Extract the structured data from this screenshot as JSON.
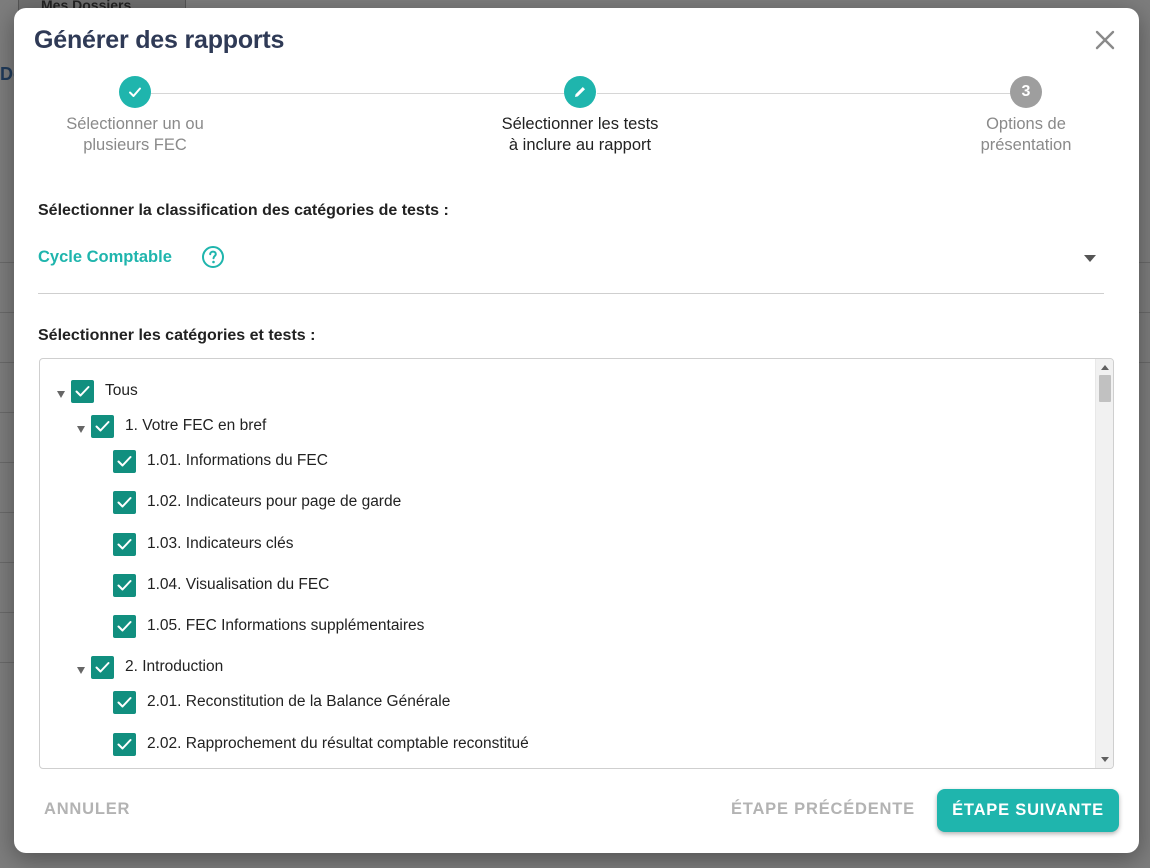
{
  "background": {
    "tab_label": "Mes Dossiers",
    "edge_text": "Do"
  },
  "modal": {
    "title": "Générer des rapports"
  },
  "stepper": {
    "steps": [
      {
        "line1": "Sélectionner un ou",
        "line2": "plusieurs FEC",
        "state": "done"
      },
      {
        "line1": "Sélectionner les tests",
        "line2": "à inclure au rapport",
        "state": "active"
      },
      {
        "line1": "Options de",
        "line2": "présentation",
        "state": "todo",
        "number": "3"
      }
    ]
  },
  "classification": {
    "label": "Sélectionner la classification des catégories de tests :",
    "selected": "Cycle Comptable"
  },
  "tree": {
    "label": "Sélectionner les catégories et tests :",
    "root": "Tous",
    "group1": "1. Votre FEC en bref",
    "g1_items": [
      "1.01. Informations du FEC",
      "1.02. Indicateurs pour page de garde",
      "1.03. Indicateurs clés",
      "1.04. Visualisation du FEC",
      "1.05. FEC Informations supplémentaires"
    ],
    "group2": "2. Introduction",
    "g2_items": [
      "2.01. Reconstitution de la Balance Générale",
      "2.02. Rapprochement du résultat comptable reconstitué"
    ]
  },
  "footer": {
    "cancel": "ANNULER",
    "previous": "ÉTAPE PRÉCÉDENTE",
    "next": "ÉTAPE SUIVANTE"
  },
  "colors": {
    "accent": "#1fb5ad",
    "checkbox": "#118f7f",
    "title": "#2f3a56"
  }
}
